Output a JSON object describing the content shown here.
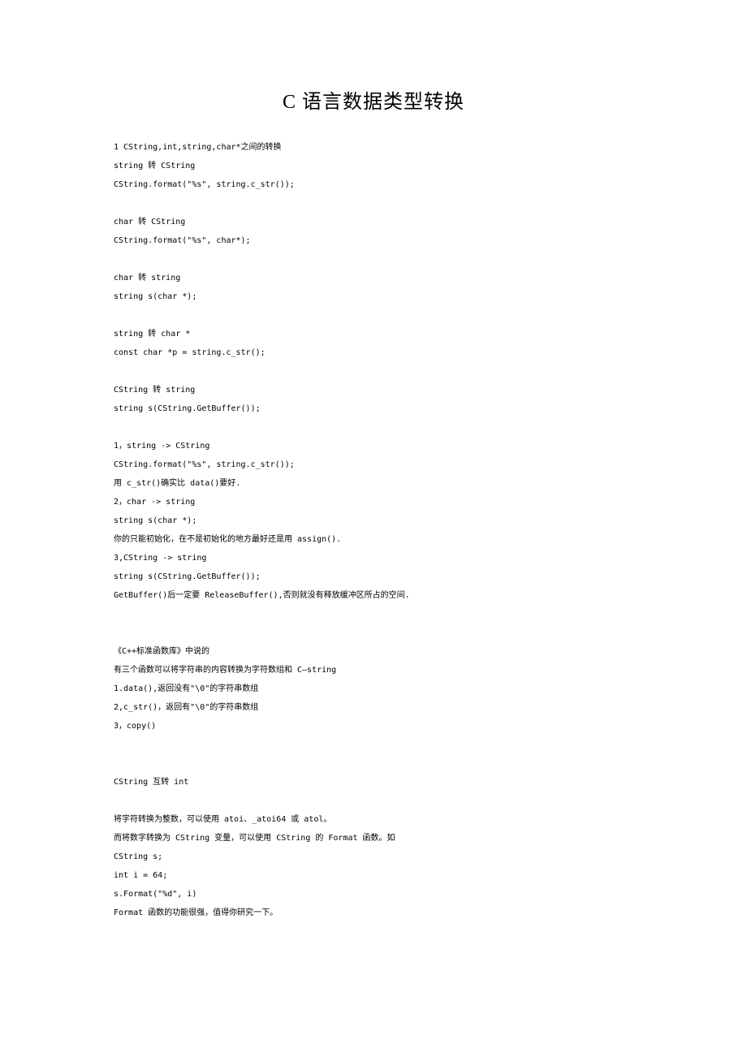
{
  "title": "C 语言数据类型转换",
  "lines": [
    "1 CString,int,string,char*之间的转换",
    "string 转 CString",
    "CString.format(\"%s\", string.c_str());",
    "",
    "char 转 CString",
    "CString.format(\"%s\", char*);",
    "",
    "char 转 string",
    "string s(char *);",
    "",
    "string 转 char *",
    "const char *p = string.c_str();",
    "",
    "CString 转 string",
    "string s(CString.GetBuffer());",
    "",
    "1，string -> CString",
    "CString.format(\"%s\", string.c_str());",
    "用 c_str()确实比 data()要好.",
    "2，char -> string",
    "string s(char *);",
    "你的只能初始化，在不是初始化的地方最好还是用 assign().",
    "3,CString -> string",
    "string s(CString.GetBuffer());",
    "GetBuffer()后一定要 ReleaseBuffer(),否则就没有释放缓冲区所占的空间.",
    "",
    "",
    "《C++标准函数库》中说的",
    "有三个函数可以将字符串的内容转换为字符数组和 C—string",
    "1.data(),返回没有\"\\0\"的字符串数组",
    "2,c_str()，返回有\"\\0\"的字符串数组",
    "3，copy()",
    "",
    "",
    "CString 互转 int",
    "",
    "将字符转换为整数，可以使用 atoi、_atoi64 或 atol。",
    "而将数字转换为 CString 变量，可以使用 CString 的 Format 函数。如",
    "CString s;",
    "int i = 64;",
    "s.Format(\"%d\", i)",
    "Format 函数的功能很强，值得你研究一下。"
  ]
}
